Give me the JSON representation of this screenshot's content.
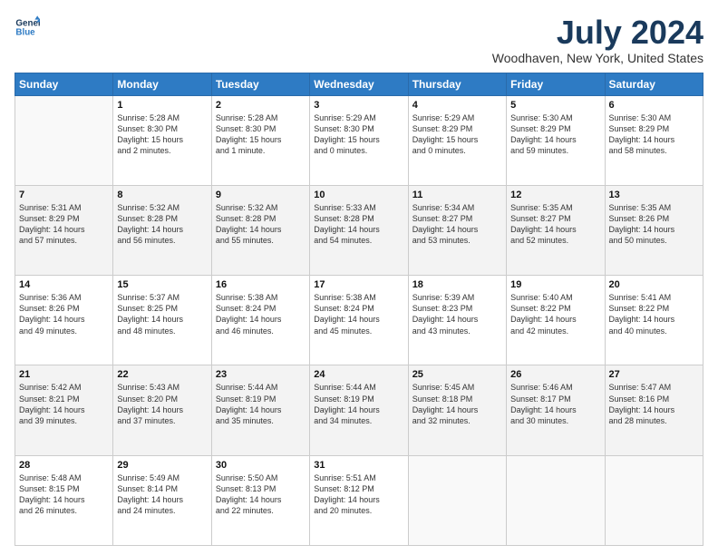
{
  "logo": {
    "line1": "General",
    "line2": "Blue"
  },
  "title": "July 2024",
  "subtitle": "Woodhaven, New York, United States",
  "weekdays": [
    "Sunday",
    "Monday",
    "Tuesday",
    "Wednesday",
    "Thursday",
    "Friday",
    "Saturday"
  ],
  "weeks": [
    [
      {
        "day": "",
        "info": ""
      },
      {
        "day": "1",
        "info": "Sunrise: 5:28 AM\nSunset: 8:30 PM\nDaylight: 15 hours\nand 2 minutes."
      },
      {
        "day": "2",
        "info": "Sunrise: 5:28 AM\nSunset: 8:30 PM\nDaylight: 15 hours\nand 1 minute."
      },
      {
        "day": "3",
        "info": "Sunrise: 5:29 AM\nSunset: 8:30 PM\nDaylight: 15 hours\nand 0 minutes."
      },
      {
        "day": "4",
        "info": "Sunrise: 5:29 AM\nSunset: 8:29 PM\nDaylight: 15 hours\nand 0 minutes."
      },
      {
        "day": "5",
        "info": "Sunrise: 5:30 AM\nSunset: 8:29 PM\nDaylight: 14 hours\nand 59 minutes."
      },
      {
        "day": "6",
        "info": "Sunrise: 5:30 AM\nSunset: 8:29 PM\nDaylight: 14 hours\nand 58 minutes."
      }
    ],
    [
      {
        "day": "7",
        "info": "Sunrise: 5:31 AM\nSunset: 8:29 PM\nDaylight: 14 hours\nand 57 minutes."
      },
      {
        "day": "8",
        "info": "Sunrise: 5:32 AM\nSunset: 8:28 PM\nDaylight: 14 hours\nand 56 minutes."
      },
      {
        "day": "9",
        "info": "Sunrise: 5:32 AM\nSunset: 8:28 PM\nDaylight: 14 hours\nand 55 minutes."
      },
      {
        "day": "10",
        "info": "Sunrise: 5:33 AM\nSunset: 8:28 PM\nDaylight: 14 hours\nand 54 minutes."
      },
      {
        "day": "11",
        "info": "Sunrise: 5:34 AM\nSunset: 8:27 PM\nDaylight: 14 hours\nand 53 minutes."
      },
      {
        "day": "12",
        "info": "Sunrise: 5:35 AM\nSunset: 8:27 PM\nDaylight: 14 hours\nand 52 minutes."
      },
      {
        "day": "13",
        "info": "Sunrise: 5:35 AM\nSunset: 8:26 PM\nDaylight: 14 hours\nand 50 minutes."
      }
    ],
    [
      {
        "day": "14",
        "info": "Sunrise: 5:36 AM\nSunset: 8:26 PM\nDaylight: 14 hours\nand 49 minutes."
      },
      {
        "day": "15",
        "info": "Sunrise: 5:37 AM\nSunset: 8:25 PM\nDaylight: 14 hours\nand 48 minutes."
      },
      {
        "day": "16",
        "info": "Sunrise: 5:38 AM\nSunset: 8:24 PM\nDaylight: 14 hours\nand 46 minutes."
      },
      {
        "day": "17",
        "info": "Sunrise: 5:38 AM\nSunset: 8:24 PM\nDaylight: 14 hours\nand 45 minutes."
      },
      {
        "day": "18",
        "info": "Sunrise: 5:39 AM\nSunset: 8:23 PM\nDaylight: 14 hours\nand 43 minutes."
      },
      {
        "day": "19",
        "info": "Sunrise: 5:40 AM\nSunset: 8:22 PM\nDaylight: 14 hours\nand 42 minutes."
      },
      {
        "day": "20",
        "info": "Sunrise: 5:41 AM\nSunset: 8:22 PM\nDaylight: 14 hours\nand 40 minutes."
      }
    ],
    [
      {
        "day": "21",
        "info": "Sunrise: 5:42 AM\nSunset: 8:21 PM\nDaylight: 14 hours\nand 39 minutes."
      },
      {
        "day": "22",
        "info": "Sunrise: 5:43 AM\nSunset: 8:20 PM\nDaylight: 14 hours\nand 37 minutes."
      },
      {
        "day": "23",
        "info": "Sunrise: 5:44 AM\nSunset: 8:19 PM\nDaylight: 14 hours\nand 35 minutes."
      },
      {
        "day": "24",
        "info": "Sunrise: 5:44 AM\nSunset: 8:19 PM\nDaylight: 14 hours\nand 34 minutes."
      },
      {
        "day": "25",
        "info": "Sunrise: 5:45 AM\nSunset: 8:18 PM\nDaylight: 14 hours\nand 32 minutes."
      },
      {
        "day": "26",
        "info": "Sunrise: 5:46 AM\nSunset: 8:17 PM\nDaylight: 14 hours\nand 30 minutes."
      },
      {
        "day": "27",
        "info": "Sunrise: 5:47 AM\nSunset: 8:16 PM\nDaylight: 14 hours\nand 28 minutes."
      }
    ],
    [
      {
        "day": "28",
        "info": "Sunrise: 5:48 AM\nSunset: 8:15 PM\nDaylight: 14 hours\nand 26 minutes."
      },
      {
        "day": "29",
        "info": "Sunrise: 5:49 AM\nSunset: 8:14 PM\nDaylight: 14 hours\nand 24 minutes."
      },
      {
        "day": "30",
        "info": "Sunrise: 5:50 AM\nSunset: 8:13 PM\nDaylight: 14 hours\nand 22 minutes."
      },
      {
        "day": "31",
        "info": "Sunrise: 5:51 AM\nSunset: 8:12 PM\nDaylight: 14 hours\nand 20 minutes."
      },
      {
        "day": "",
        "info": ""
      },
      {
        "day": "",
        "info": ""
      },
      {
        "day": "",
        "info": ""
      }
    ]
  ]
}
